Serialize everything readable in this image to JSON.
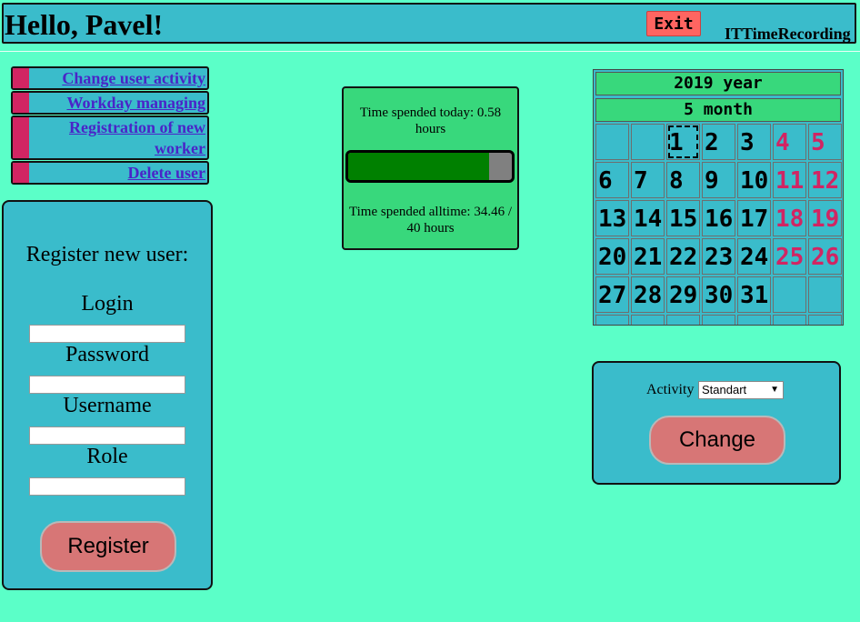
{
  "header": {
    "greeting": "Hello, Pavel!",
    "exit_label": "Exit",
    "brand": "ITTimeRecording"
  },
  "menu": [
    {
      "label": "Change user activity"
    },
    {
      "label": "Workday managing"
    },
    {
      "label": "Registration of new worker"
    },
    {
      "label": "Delete user"
    }
  ],
  "register": {
    "title": "Register new user:",
    "login_label": "Login",
    "password_label": "Password",
    "username_label": "Username",
    "role_label": "Role",
    "login_value": "",
    "password_value": "",
    "username_value": "",
    "role_value": "",
    "button_label": "Register"
  },
  "time": {
    "today_text": "Time spended today: 0.58 hours",
    "alltime_text": "Time spended alltime: 34.46 / 40 hours",
    "progress_fraction": 0.8615
  },
  "calendar": {
    "year_label": "2019 year",
    "month_label": "5 month",
    "today": "1",
    "weeks": [
      [
        "",
        "",
        "1",
        "2",
        "3",
        "4",
        "5"
      ],
      [
        "6",
        "7",
        "8",
        "9",
        "10",
        "11",
        "12"
      ],
      [
        "13",
        "14",
        "15",
        "16",
        "17",
        "18",
        "19"
      ],
      [
        "20",
        "21",
        "22",
        "23",
        "24",
        "25",
        "26"
      ],
      [
        "27",
        "28",
        "29",
        "30",
        "31",
        "",
        ""
      ]
    ],
    "weekend_color": "#d12563"
  },
  "activity": {
    "label": "Activity",
    "selected": "Standart",
    "button_label": "Change"
  },
  "colors": {
    "background": "#5bffc8",
    "panel": "#3abccb",
    "accent": "#d12563",
    "progress": "#008000",
    "button": "#d77676"
  }
}
